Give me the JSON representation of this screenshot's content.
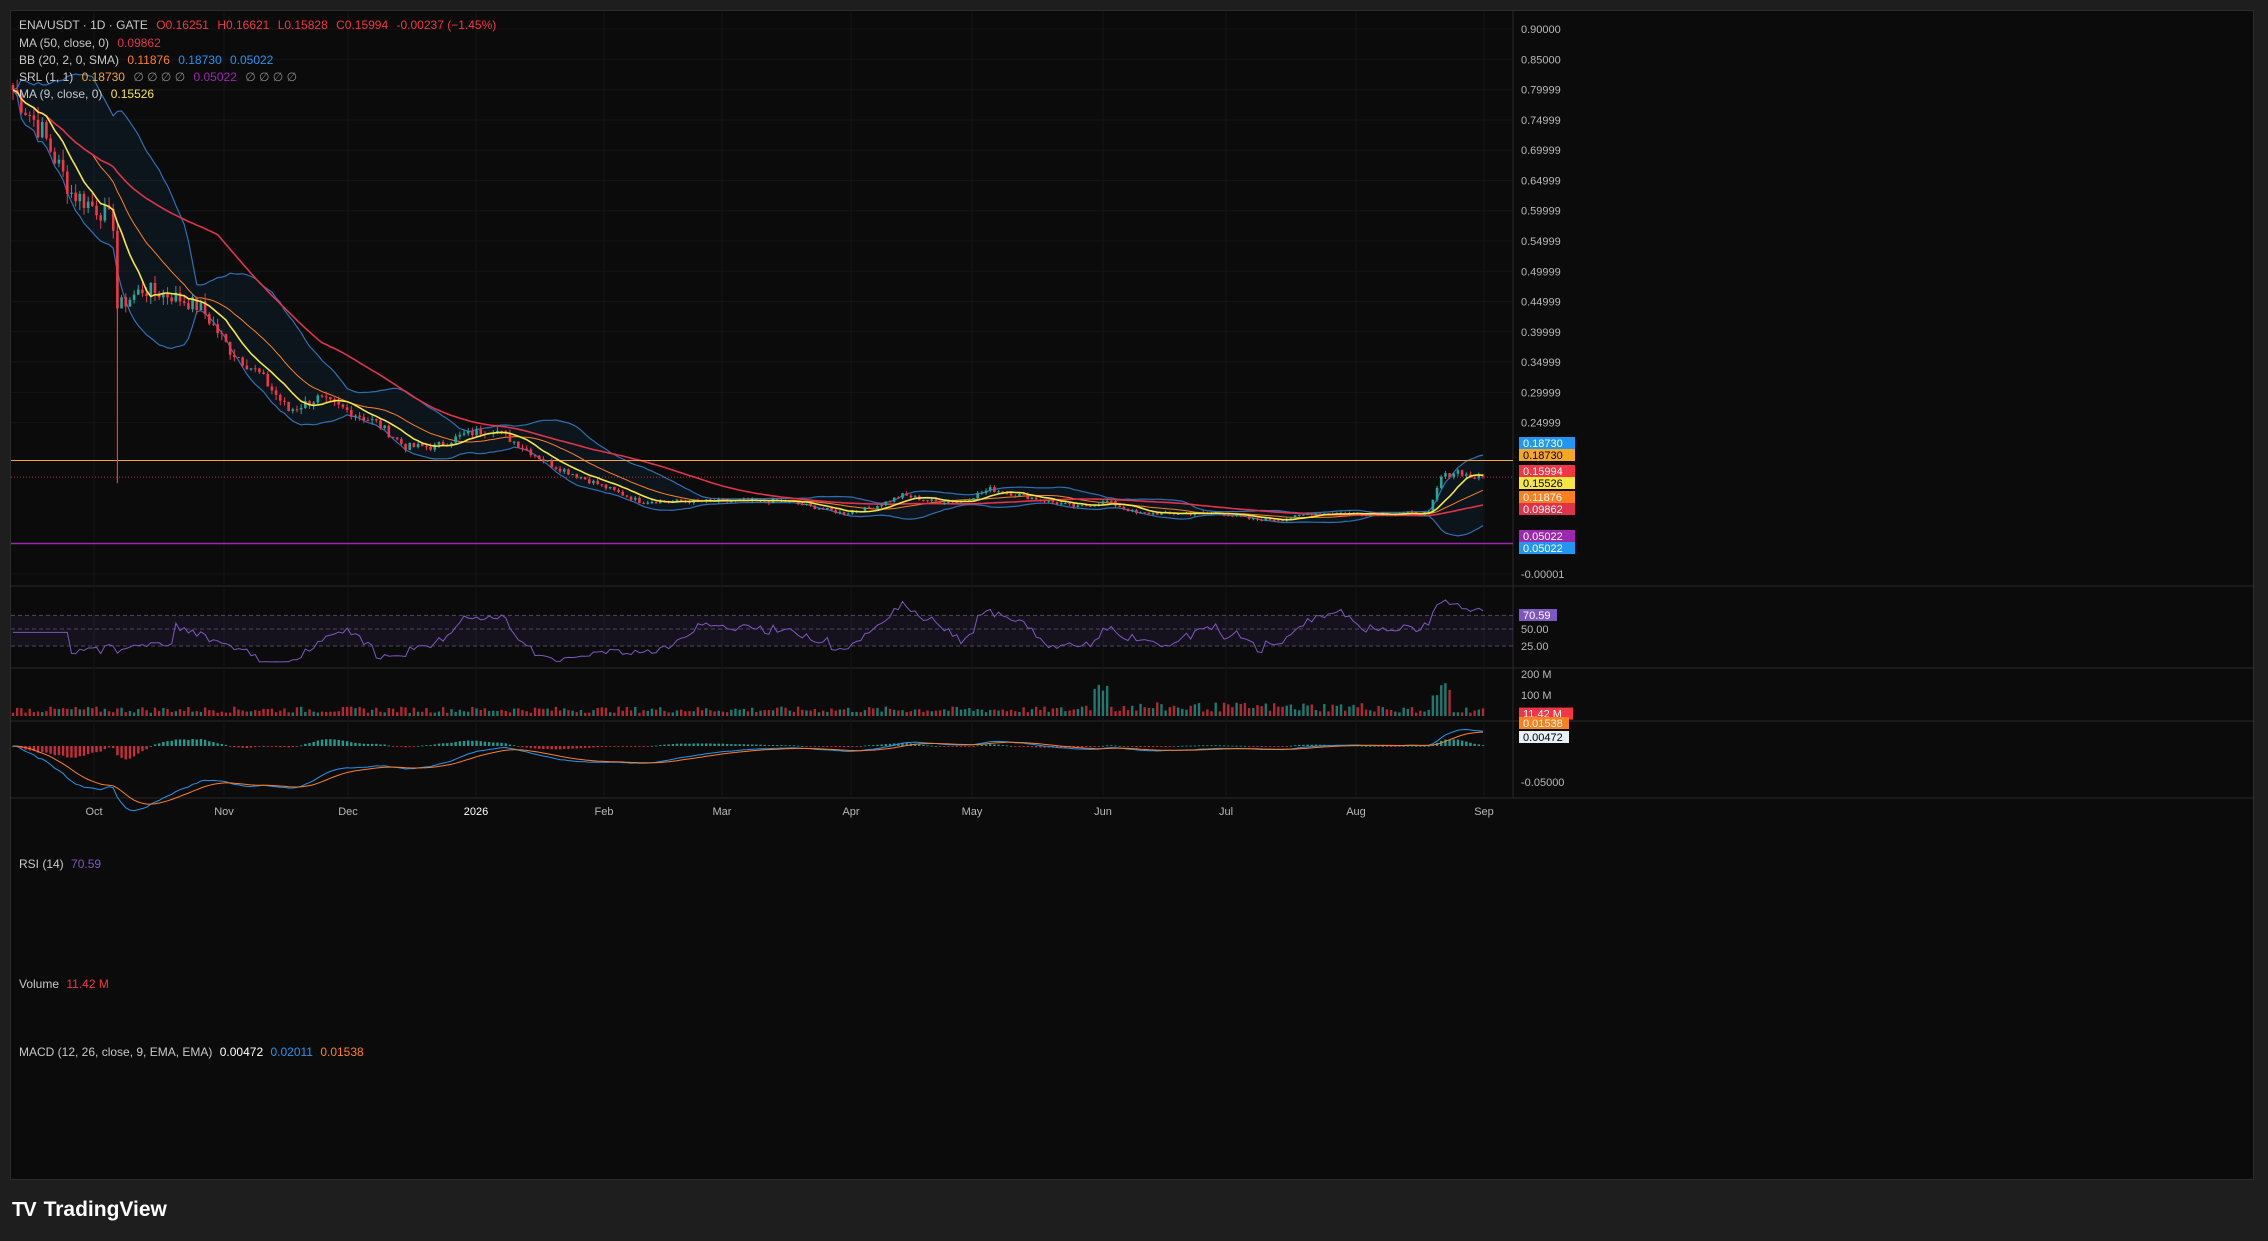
{
  "header": {
    "symbol": "ENA/USDT · 1D · GATE",
    "ohlc": {
      "open": "O0.16251",
      "high": "H0.16621",
      "low": "L0.15828",
      "close": "C0.15994",
      "change": "-0.00237 (−1.45%)"
    },
    "ma50": {
      "label": "MA (50, close, 0)",
      "value": "0.09862"
    },
    "bb": {
      "label": "BB (20, 2, 0, SMA)",
      "basis": "0.11876",
      "upper": "0.18730",
      "lower": "0.05022"
    },
    "srl": {
      "label": "SRL (1, 1)",
      "v1": "0.18730",
      "dots1": "∅ ∅ ∅ ∅",
      "v2": "0.05022",
      "dots2": "∅ ∅ ∅ ∅"
    },
    "ma9": {
      "label": "MA (9, close, 0)",
      "value": "0.15526"
    }
  },
  "panes": {
    "rsi": {
      "label": "RSI (14)",
      "value": "70.59",
      "levels": [
        "70.00",
        "50.00",
        "25.00"
      ]
    },
    "volume": {
      "label": "Volume",
      "value": "11.42 M",
      "ticks": [
        "200 M",
        "100 M"
      ]
    },
    "macd": {
      "label": "MACD (12, 26, close, 9, EMA, EMA)",
      "v1": "0.00472",
      "v2": "0.02011",
      "v3": "0.01538",
      "ticks": [
        "-0.05000"
      ]
    }
  },
  "price_tags": [
    {
      "text": "0.18730",
      "color": "#2196f3"
    },
    {
      "text": "0.18730",
      "color": "#f5a623"
    },
    {
      "text": "0.15994",
      "color": "#f23645"
    },
    {
      "text": "0.15526",
      "color": "#f5e642"
    },
    {
      "text": "0.11876",
      "color": "#ff7f1f"
    },
    {
      "text": "0.09862",
      "color": "#e0334a"
    },
    {
      "text": "0.05022",
      "color": "#9c27b0"
    },
    {
      "text": "0.05022",
      "color": "#2196f3"
    }
  ],
  "pane_tags": {
    "rsi": "70.59",
    "volume": "11.42 M",
    "macd1": "0.01538",
    "macd2": "0.00472"
  },
  "footer": {
    "brand": "TradingView"
  },
  "colors": {
    "up": "#26a69a",
    "down": "#f23645",
    "ma9": "#f5e642",
    "ma50": "#e0334a",
    "bb_basis": "#ff7f1f",
    "bb_band": "#2962ff",
    "srl_high": "#f5a623",
    "srl_low": "#9c27b0",
    "rsi": "#7e57c2"
  },
  "chart_data": {
    "type": "candlestick",
    "title": "ENA/USDT · 1D · GATE",
    "ylim": [
      -0.02,
      0.93
    ],
    "y_ticks": [
      "0.90000",
      "0.85000",
      "0.79999",
      "0.74999",
      "0.69999",
      "0.64999",
      "0.59999",
      "0.54999",
      "0.49999",
      "0.44999",
      "0.39999",
      "0.34999",
      "0.29999",
      "0.24999",
      "-0.00001"
    ],
    "x_ticks": [
      "Oct",
      "Nov",
      "Dec",
      "2026",
      "Feb",
      "Mar",
      "Apr",
      "May",
      "Jun",
      "Jul",
      "Aug",
      "Sep"
    ],
    "close_series": [
      [
        "Sep 15",
        0.8
      ],
      [
        "Sep 22",
        0.73
      ],
      [
        "Sep 29",
        0.63
      ],
      [
        "Oct 6",
        0.6
      ],
      [
        "Oct 9",
        0.58
      ],
      [
        "Oct 10",
        0.44
      ],
      [
        "Oct 16",
        0.47
      ],
      [
        "Oct 23",
        0.46
      ],
      [
        "Oct 30",
        0.44
      ],
      [
        "Nov 6",
        0.37
      ],
      [
        "Nov 13",
        0.33
      ],
      [
        "Nov 20",
        0.27
      ],
      [
        "Nov 27",
        0.29
      ],
      [
        "Dec 4",
        0.27
      ],
      [
        "Dec 11",
        0.25
      ],
      [
        "Dec 18",
        0.21
      ],
      [
        "Dec 25",
        0.21
      ],
      [
        "Jan 1",
        0.23
      ],
      [
        "Jan 8",
        0.24
      ],
      [
        "Jan 15",
        0.21
      ],
      [
        "Jan 22",
        0.18
      ],
      [
        "Jan 29",
        0.16
      ],
      [
        "Feb 5",
        0.14
      ],
      [
        "Feb 12",
        0.12
      ],
      [
        "Feb 19",
        0.12
      ],
      [
        "Feb 26",
        0.12
      ],
      [
        "Mar 5",
        0.12
      ],
      [
        "Mar 12",
        0.12
      ],
      [
        "Mar 19",
        0.12
      ],
      [
        "Mar 26",
        0.11
      ],
      [
        "Apr 2",
        0.1
      ],
      [
        "Apr 9",
        0.11
      ],
      [
        "Apr 16",
        0.13
      ],
      [
        "Apr 23",
        0.12
      ],
      [
        "Apr 30",
        0.12
      ],
      [
        "May 7",
        0.14
      ],
      [
        "May 14",
        0.13
      ],
      [
        "May 21",
        0.12
      ],
      [
        "May 28",
        0.11
      ],
      [
        "Jun 4",
        0.12
      ],
      [
        "Jun 11",
        0.1
      ],
      [
        "Jun 18",
        0.1
      ],
      [
        "Jun 25",
        0.1
      ],
      [
        "Jul 2",
        0.1
      ],
      [
        "Jul 9",
        0.09
      ],
      [
        "Jul 16",
        0.09
      ],
      [
        "Jul 23",
        0.1
      ],
      [
        "Jul 30",
        0.1
      ],
      [
        "Aug 6",
        0.1
      ],
      [
        "Aug 13",
        0.1
      ],
      [
        "Aug 20",
        0.1
      ],
      [
        "Aug 23",
        0.16
      ],
      [
        "Aug 27",
        0.17
      ],
      [
        "Aug 30",
        0.16
      ]
    ],
    "series": [
      {
        "name": "MA (9, close, 0)",
        "last": 0.15526
      },
      {
        "name": "MA (50, close, 0)",
        "last": 0.09862
      },
      {
        "name": "BB (20, 2, 0, SMA)",
        "basis": 0.11876,
        "upper": 0.1873,
        "lower": 0.05022
      },
      {
        "name": "SRL (1, 1)",
        "levels": [
          0.1873,
          0.05022
        ]
      }
    ],
    "rsi": {
      "last": 70.59,
      "levels": [
        70,
        50,
        25
      ]
    },
    "volume": {
      "last_M": 11.42,
      "ylim_M": [
        0,
        200
      ]
    },
    "macd": {
      "macd": 0.00472,
      "signal": 0.01538,
      "hist": 0.02011
    }
  }
}
